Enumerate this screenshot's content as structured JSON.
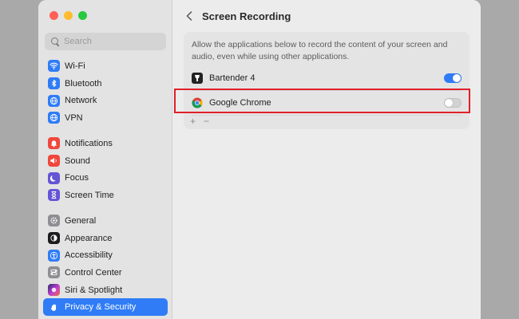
{
  "search": {
    "placeholder": "Search"
  },
  "sidebar": {
    "groups": [
      [
        {
          "label": "Wi-Fi",
          "icon": "wifi-icon",
          "color": "#2f7cf6"
        },
        {
          "label": "Bluetooth",
          "icon": "bluetooth-icon",
          "color": "#2f7cf6"
        },
        {
          "label": "Network",
          "icon": "globe-icon",
          "color": "#2f7cf6"
        },
        {
          "label": "VPN",
          "icon": "globe-icon",
          "color": "#2f7cf6"
        }
      ],
      [
        {
          "label": "Notifications",
          "icon": "bell-icon",
          "color": "#f0473c"
        },
        {
          "label": "Sound",
          "icon": "speaker-icon",
          "color": "#f0473c"
        },
        {
          "label": "Focus",
          "icon": "moon-icon",
          "color": "#6455d6"
        },
        {
          "label": "Screen Time",
          "icon": "hourglass-icon",
          "color": "#6455d6"
        }
      ],
      [
        {
          "label": "General",
          "icon": "gear-icon",
          "color": "#8e8e93"
        },
        {
          "label": "Appearance",
          "icon": "appearance-icon",
          "color": "#1c1c1e"
        },
        {
          "label": "Accessibility",
          "icon": "accessibility-icon",
          "color": "#2f7cf6"
        },
        {
          "label": "Control Center",
          "icon": "control-center-icon",
          "color": "#8e8e93"
        },
        {
          "label": "Siri & Spotlight",
          "icon": "siri-icon",
          "color": "#c23fcf"
        },
        {
          "label": "Privacy & Security",
          "icon": "hand-icon",
          "color": "#2f7cf6",
          "selected": true
        }
      ]
    ]
  },
  "main": {
    "title": "Screen Recording",
    "description": "Allow the applications below to record the content of your screen and audio, even while using other applications.",
    "apps": [
      {
        "name": "Bartender 4",
        "enabled": true
      },
      {
        "name": "Google Chrome",
        "enabled": false
      }
    ],
    "add_label": "+",
    "remove_label": "−"
  },
  "colors": {
    "accent": "#2f7cf6",
    "highlight": "#e0202a"
  }
}
